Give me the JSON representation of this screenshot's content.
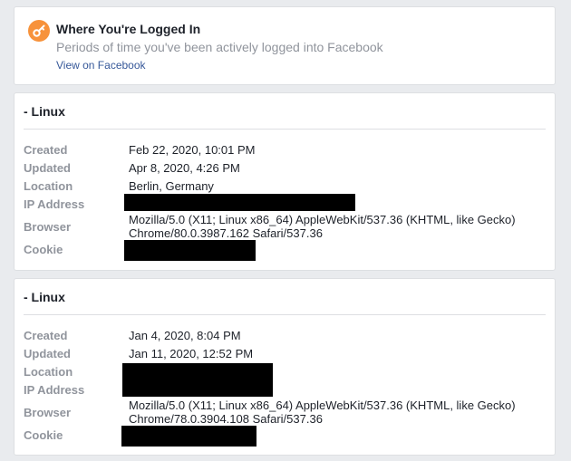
{
  "header": {
    "title": "Where You're Logged In",
    "subtitle": "Periods of time you've been actively logged into Facebook",
    "link": "View on Facebook",
    "icon": "key-icon",
    "icon_color": "#f7923b"
  },
  "labels": {
    "created": "Created",
    "updated": "Updated",
    "location": "Location",
    "ip": "IP Address",
    "browser": "Browser",
    "cookie": "Cookie"
  },
  "sessions": [
    {
      "title": "- Linux",
      "created": "Feb 22, 2020, 10:01 PM",
      "updated": "Apr 8, 2020, 4:26 PM",
      "location": "Berlin, Germany",
      "browser_line1": "Mozilla/5.0 (X11; Linux x86_64) AppleWebKit/537.36 (KHTML, like Gecko)",
      "browser_line2": "Chrome/80.0.3987.162 Safari/537.36"
    },
    {
      "title": "- Linux",
      "created": "Jan 4, 2020, 8:04 PM",
      "updated": "Jan 11, 2020, 12:52 PM",
      "browser_line1": "Mozilla/5.0 (X11; Linux x86_64) AppleWebKit/537.36 (KHTML, like Gecko)",
      "browser_line2": "Chrome/78.0.3904.108 Safari/537.36"
    }
  ]
}
